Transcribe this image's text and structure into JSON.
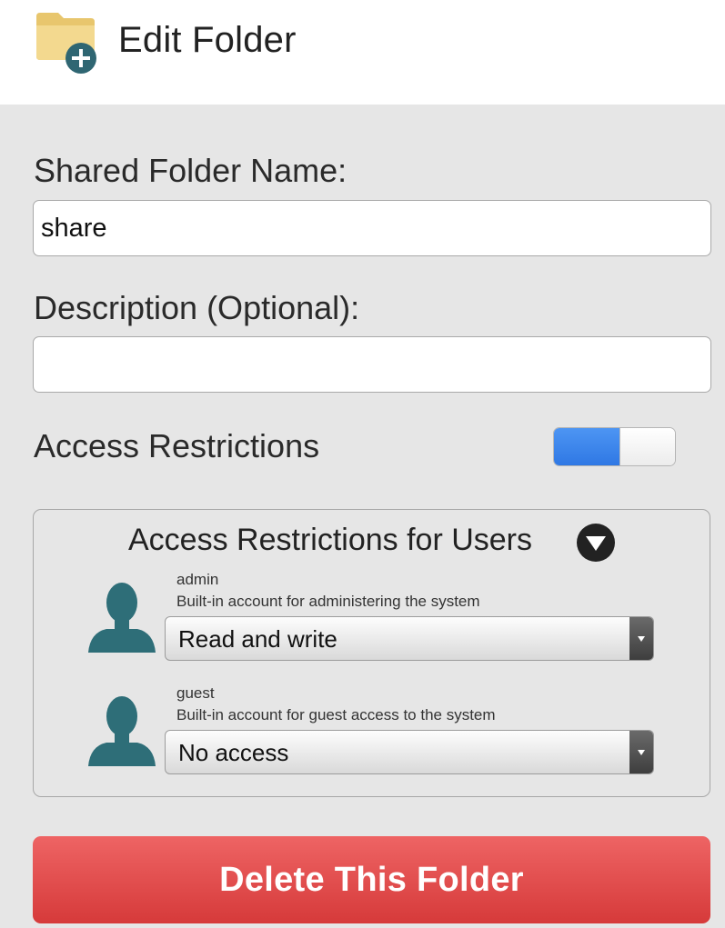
{
  "header": {
    "title": "Edit Folder",
    "icon": "folder-add-icon"
  },
  "form": {
    "name_label": "Shared Folder Name:",
    "name_value": "share",
    "description_label": "Description (Optional):",
    "description_value": "",
    "access_label": "Access Restrictions",
    "access_enabled": true
  },
  "access_users": {
    "title": "Access Restrictions for Users",
    "users": [
      {
        "name": "admin",
        "description": "Built-in account for administering the system",
        "permission": "Read and write",
        "icon": "user-icon"
      },
      {
        "name": "guest",
        "description": "Built-in account for guest access to the system",
        "permission": "No access",
        "icon": "user-icon"
      }
    ]
  },
  "actions": {
    "delete_label": "Delete This Folder"
  },
  "colors": {
    "toggle_on": "#3a86ee",
    "delete": "#e04848",
    "avatar": "#2e6e78",
    "folder": "#f0d488",
    "badge": "#2f6672"
  }
}
